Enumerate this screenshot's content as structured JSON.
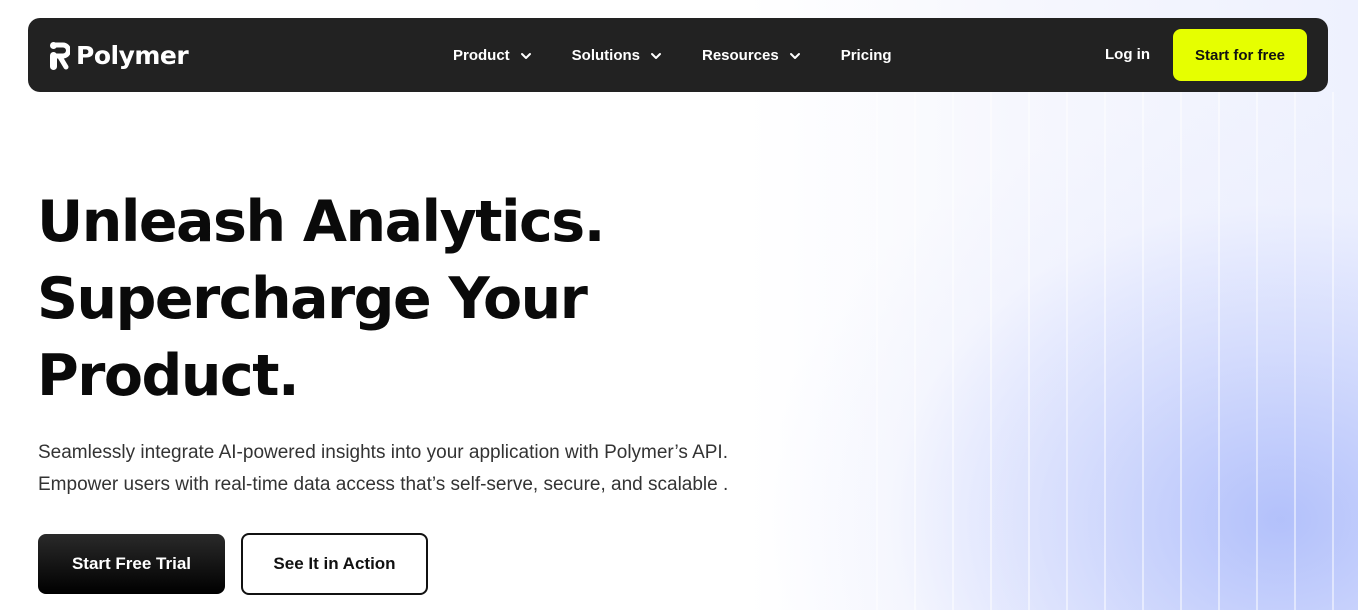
{
  "brand": {
    "name": "Polymer",
    "logo_icon": "polymer-logo-icon",
    "accent_color": "#e6ff00",
    "nav_background": "#222222"
  },
  "nav": {
    "items": [
      {
        "label": "Product",
        "has_dropdown": true,
        "icon": "chevron-down-icon"
      },
      {
        "label": "Solutions",
        "has_dropdown": true,
        "icon": "chevron-down-icon"
      },
      {
        "label": "Resources",
        "has_dropdown": true,
        "icon": "chevron-down-icon"
      },
      {
        "label": "Pricing",
        "has_dropdown": false
      }
    ],
    "login_label": "Log in",
    "cta_label": "Start for free"
  },
  "hero": {
    "headline": [
      "Unleash Analytics.",
      "Supercharge Your",
      "Product."
    ],
    "subtext": [
      "Seamlessly integrate AI-powered insights into your application with Polymer’s API.",
      "Empower users with real-time data access that’s self-serve, secure, and scalable ."
    ],
    "primary_button": "Start Free Trial",
    "secondary_button": "See It in Action"
  }
}
